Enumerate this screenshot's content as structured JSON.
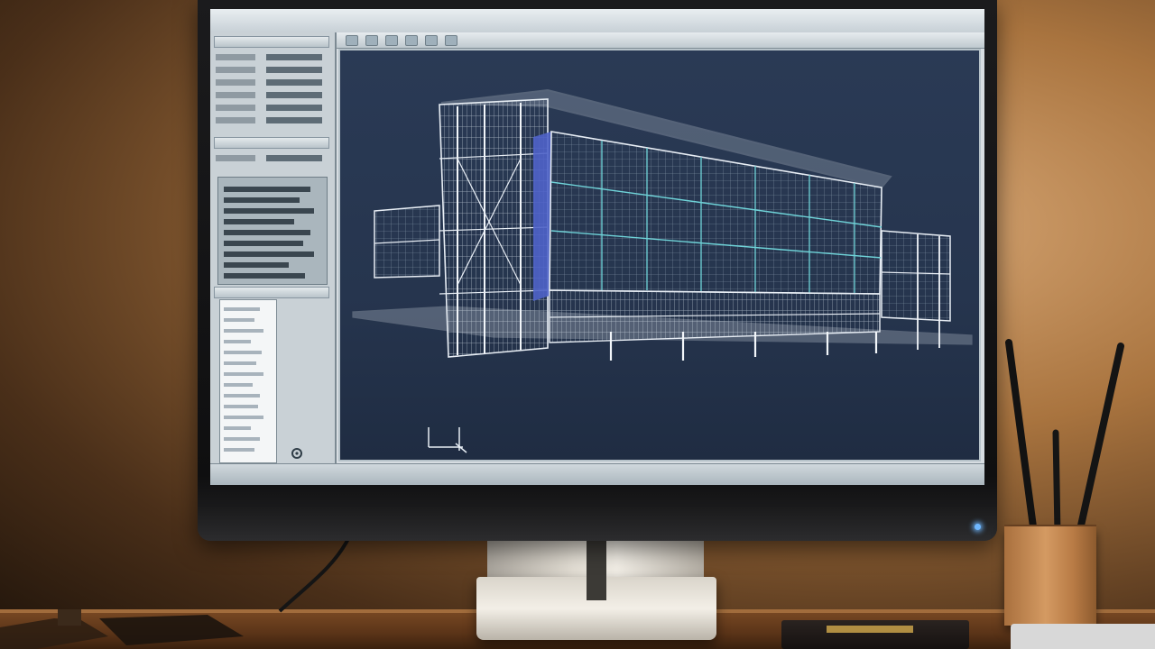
{
  "scene": {
    "description_colors": {
      "wall_warm": "#d9a977",
      "viewport_bg": "#26354e",
      "wire_cyan": "#6fd3d8",
      "wire_white": "#e8eef5",
      "accent_blue": "#4f63c9",
      "led_blue": "#6fb7ff"
    }
  },
  "cad_app": {
    "title": "",
    "right_title": "",
    "toolbar_items": [],
    "left_panel": {
      "sections": [
        {
          "title": ""
        },
        {
          "title": ""
        },
        {
          "title": ""
        }
      ]
    },
    "status_left": "",
    "status_right": ""
  },
  "icons": {
    "axis_gizmo": "axis-gizmo-icon",
    "power_led": "power-led-icon"
  }
}
